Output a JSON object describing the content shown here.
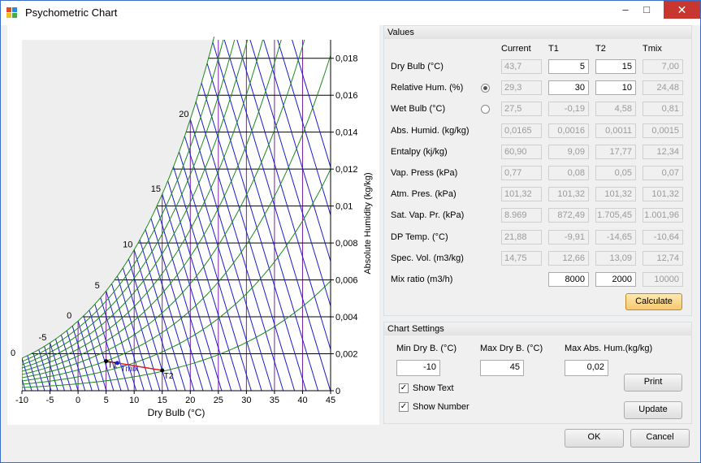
{
  "window": {
    "title": "Psychometric Chart",
    "minimize": "–",
    "maximize": "□",
    "close": "✕"
  },
  "chart": {
    "xlabel": "Dry Bulb (°C)",
    "ylabel": "Absolute Humidity (kg/kg)",
    "x_ticks": [
      "-10",
      "-5",
      "0",
      "5",
      "10",
      "15",
      "20",
      "25",
      "30",
      "35",
      "40",
      "45"
    ],
    "y_ticks": [
      "0",
      "0,002",
      "0,004",
      "0,006",
      "0,008",
      "0,01",
      "0,012",
      "0,014",
      "0,016",
      "0,018"
    ],
    "wb_labels": [
      "0",
      "-5",
      "0",
      "5",
      "10",
      "15",
      "20"
    ],
    "point_labels": [
      "T1",
      "Tmix",
      "T2"
    ]
  },
  "chart_data": {
    "type": "line",
    "xlabel": "Dry Bulb (°C)",
    "ylabel": "Absolute Humidity (kg/kg)",
    "xlim": [
      -10,
      45
    ],
    "ylim": [
      0,
      0.019
    ],
    "points": [
      {
        "name": "T1",
        "x": 5,
        "y": 0.0016
      },
      {
        "name": "Tmix",
        "x": 7,
        "y": 0.0015
      },
      {
        "name": "T2",
        "x": 15,
        "y": 0.0011
      }
    ],
    "grid": true
  },
  "values": {
    "title": "Values",
    "headers": [
      "Current",
      "T1",
      "T2",
      "Tmix"
    ],
    "rows": [
      {
        "label": "Dry Bulb (°C)",
        "current": "43,7",
        "t1": "5",
        "t2": "15",
        "tmix": "7,00"
      },
      {
        "label": "Relative Hum.  (%)",
        "current": "29,3",
        "t1": "30",
        "t2": "10",
        "tmix": "24,48"
      },
      {
        "label": "Wet Bulb (°C)",
        "current": "27,5",
        "t1": "-0,19",
        "t2": "4,58",
        "tmix": "0,81"
      },
      {
        "label": "Abs. Humid. (kg/kg)",
        "current": "0,0165",
        "t1": "0,0016",
        "t2": "0,0011",
        "tmix": "0,0015"
      },
      {
        "label": "Entalpy (kj/kg)",
        "current": "60,90",
        "t1": "9,09",
        "t2": "17,77",
        "tmix": "12,34"
      },
      {
        "label": "Vap. Press (kPa)",
        "current": "0,77",
        "t1": "0,08",
        "t2": "0,05",
        "tmix": "0,07"
      },
      {
        "label": "Atm. Pres. (kPa)",
        "current": "101,32",
        "t1": "101,32",
        "t2": "101,32",
        "tmix": "101,32"
      },
      {
        "label": "Sat. Vap. Pr. (kPa)",
        "current": "8.969",
        "t1": "872,49",
        "t2": "1.705,45",
        "tmix": "1.001,96"
      },
      {
        "label": "DP Temp. (°C)",
        "current": "21,88",
        "t1": "-9,91",
        "t2": "-14,65",
        "tmix": "-10,64"
      },
      {
        "label": "Spec. Vol. (m3/kg)",
        "current": "14,75",
        "t1": "12,66",
        "t2": "13,09",
        "tmix": "12,74"
      },
      {
        "label": "Mix ratio (m3/h)",
        "t1": "8000",
        "t2": "2000",
        "tmix": "10000"
      }
    ],
    "calculate": "Calculate"
  },
  "settings": {
    "title": "Chart Settings",
    "min_dry_label": "Min Dry B. (°C)",
    "min_dry": "-10",
    "max_dry_label": "Max Dry B. (°C)",
    "max_dry": "45",
    "max_abs_label": "Max Abs. Hum.(kg/kg)",
    "max_abs": "0,02",
    "show_text": "Show Text",
    "show_number": "Show Number",
    "print": "Print",
    "update": "Update"
  },
  "footer": {
    "ok": "OK",
    "cancel": "Cancel"
  }
}
